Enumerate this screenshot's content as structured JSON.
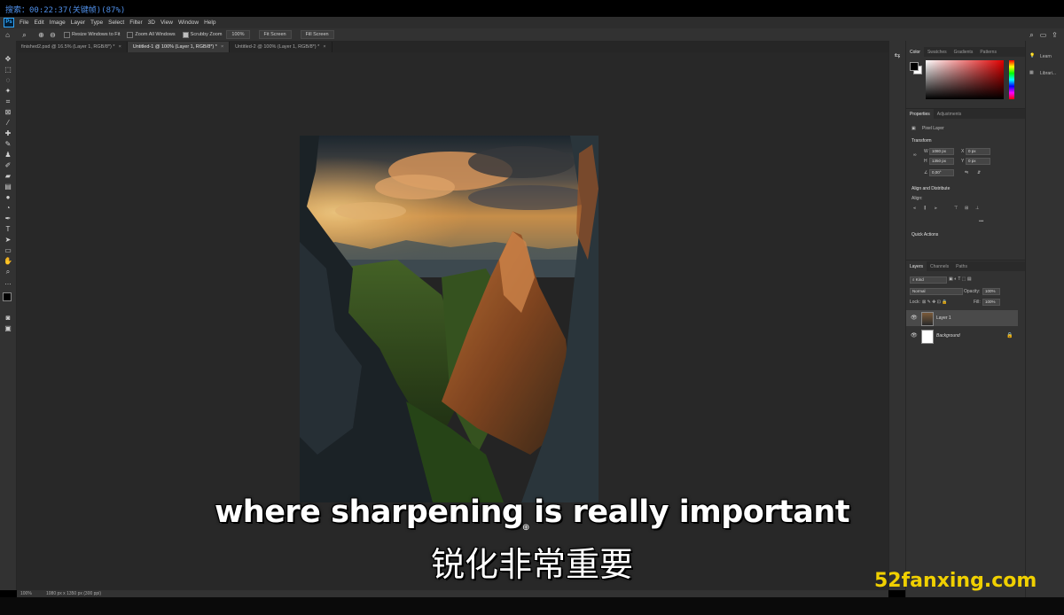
{
  "recording": {
    "text": "搜索：00:22:37(关键帧)(87%)"
  },
  "menubar": {
    "logo": "Ps",
    "items": [
      "File",
      "Edit",
      "Image",
      "Layer",
      "Type",
      "Select",
      "Filter",
      "3D",
      "View",
      "Window",
      "Help"
    ]
  },
  "options": {
    "resize_windows": "Resize Windows to Fit",
    "zoom_all": "Zoom All Windows",
    "scrubby_zoom": "Scrubby Zoom",
    "zoom_pct": "100%",
    "fit_screen": "Fit Screen",
    "fill_screen": "Fill Screen"
  },
  "tabs": [
    {
      "label": "finished2.psd @ 16.5% (Layer 1, RGB/8*) *",
      "active": false
    },
    {
      "label": "Untitled-1 @ 100% (Layer 1, RGB/8*) *",
      "active": true
    },
    {
      "label": "Untitled-2 @ 100% (Layer 1, RGB/8*) *",
      "active": false
    }
  ],
  "tab_close": "×",
  "status": {
    "zoom": "100%",
    "doc_size": "1080 px x 1350 px (300 ppi)"
  },
  "color_panel": {
    "tabs": [
      "Color",
      "Swatches",
      "Gradients",
      "Patterns"
    ],
    "foreground": "#000000",
    "background": "#ffffff",
    "picked": "#e00000"
  },
  "properties": {
    "tabs": [
      "Properties",
      "Adjustments"
    ],
    "layer_type": "Pixel Layer",
    "transform_title": "Transform",
    "w_label": "W",
    "w_value": "1080 px",
    "h_label": "H",
    "h_value": "1350 px",
    "x_label": "X",
    "x_value": "0 px",
    "y_label": "Y",
    "y_value": "0 px",
    "angle_value": "0,00°",
    "align_title": "Align and Distribute",
    "align_label": "Align:",
    "more": "•••",
    "quick_actions": "Quick Actions"
  },
  "layers": {
    "tabs": [
      "Layers",
      "Channels",
      "Paths"
    ],
    "kind": "Kind",
    "blend_mode": "Normal",
    "opacity_label": "Opacity:",
    "opacity_value": "100%",
    "lock_label": "Lock:",
    "fill_label": "Fill:",
    "fill_value": "100%",
    "items": [
      {
        "name": "Layer 1",
        "selected": true
      },
      {
        "name": "Background",
        "selected": false
      }
    ]
  },
  "right_strip": {
    "learn": "Learn",
    "libraries": "Librari..."
  },
  "subtitles": {
    "en": "where sharpening is really important",
    "zh": "锐化非常重要"
  },
  "watermark": "52fanxing.com"
}
